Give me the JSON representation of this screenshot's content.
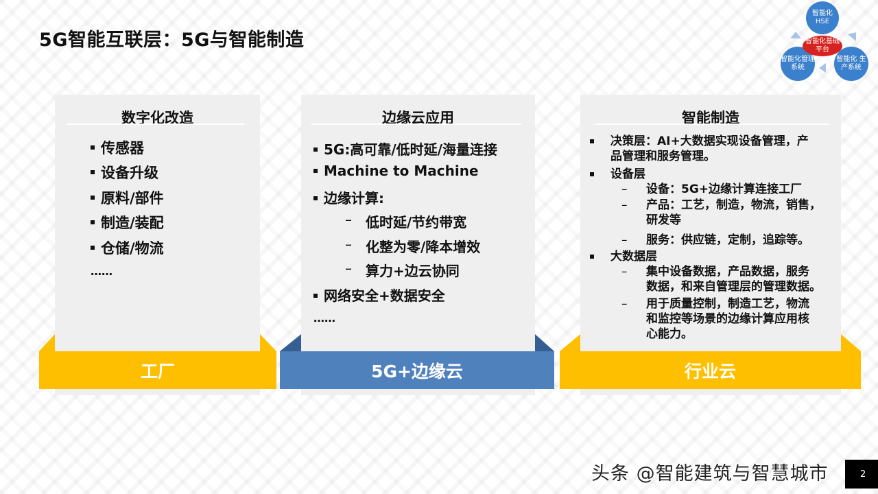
{
  "slide": {
    "title": "5G智能互联层：5G与智能制造",
    "page_number": "2"
  },
  "diagram": {
    "top_circle": "智能化HSE",
    "left_circle": "智能化管理系统",
    "right_circle": "智能化 生产系统",
    "center_ellipse": "智能化基础平台",
    "circle_color": "#3a80cc",
    "center_color": "#d8221f"
  },
  "columns": [
    {
      "heading": "数字化改造",
      "items": [
        "传感器",
        "设备升级",
        "原料/部件",
        "制造/装配",
        "仓储/物流"
      ],
      "ellipsis": "……",
      "ribbon_label": "工厂",
      "ribbon_color": "#fdbf00"
    },
    {
      "heading": "边缘云应用",
      "items": [
        "5G:高可靠/低时延/海量连接",
        "Machine to Machine",
        "边缘计算:"
      ],
      "subitems": [
        "低时延/节约带宽",
        "化整为零/降本增效",
        "算力+边云协同"
      ],
      "items_after": [
        "网络安全+数据安全"
      ],
      "ellipsis": "……",
      "ribbon_label": "5G+边缘云",
      "ribbon_color": "#4f81bd"
    },
    {
      "heading": "智能制造",
      "sections": [
        {
          "label": "决策层：AI+大数据实现设备管理，产品管理和服务管理。",
          "lines": [
            "决策层：AI+大数据实现设备管理，产",
            "品管理和服务管理。"
          ]
        },
        {
          "label": "设备层",
          "subitems": [
            {
              "lines": [
                "设备：5G+边缘计算连接工厂"
              ]
            },
            {
              "lines": [
                "产品：工艺，制造，物流，销售，",
                "研发等"
              ]
            },
            {
              "lines": [
                "服务：供应链，定制，追踪等。"
              ]
            }
          ]
        },
        {
          "label": "大数据层",
          "subitems": [
            {
              "lines": [
                "集中设备数据，产品数据，服务",
                "数据，和来自管理层的管理数据。"
              ]
            },
            {
              "lines": [
                "用于质量控制，制造工艺，物流",
                "和监控等场景的边缘计算应用核",
                "心能力。"
              ]
            }
          ]
        }
      ],
      "ribbon_label": "行业云",
      "ribbon_color": "#fdbf00"
    }
  ],
  "dash_glyph": "–",
  "watermark": "头条 @智能建筑与智慧城市"
}
